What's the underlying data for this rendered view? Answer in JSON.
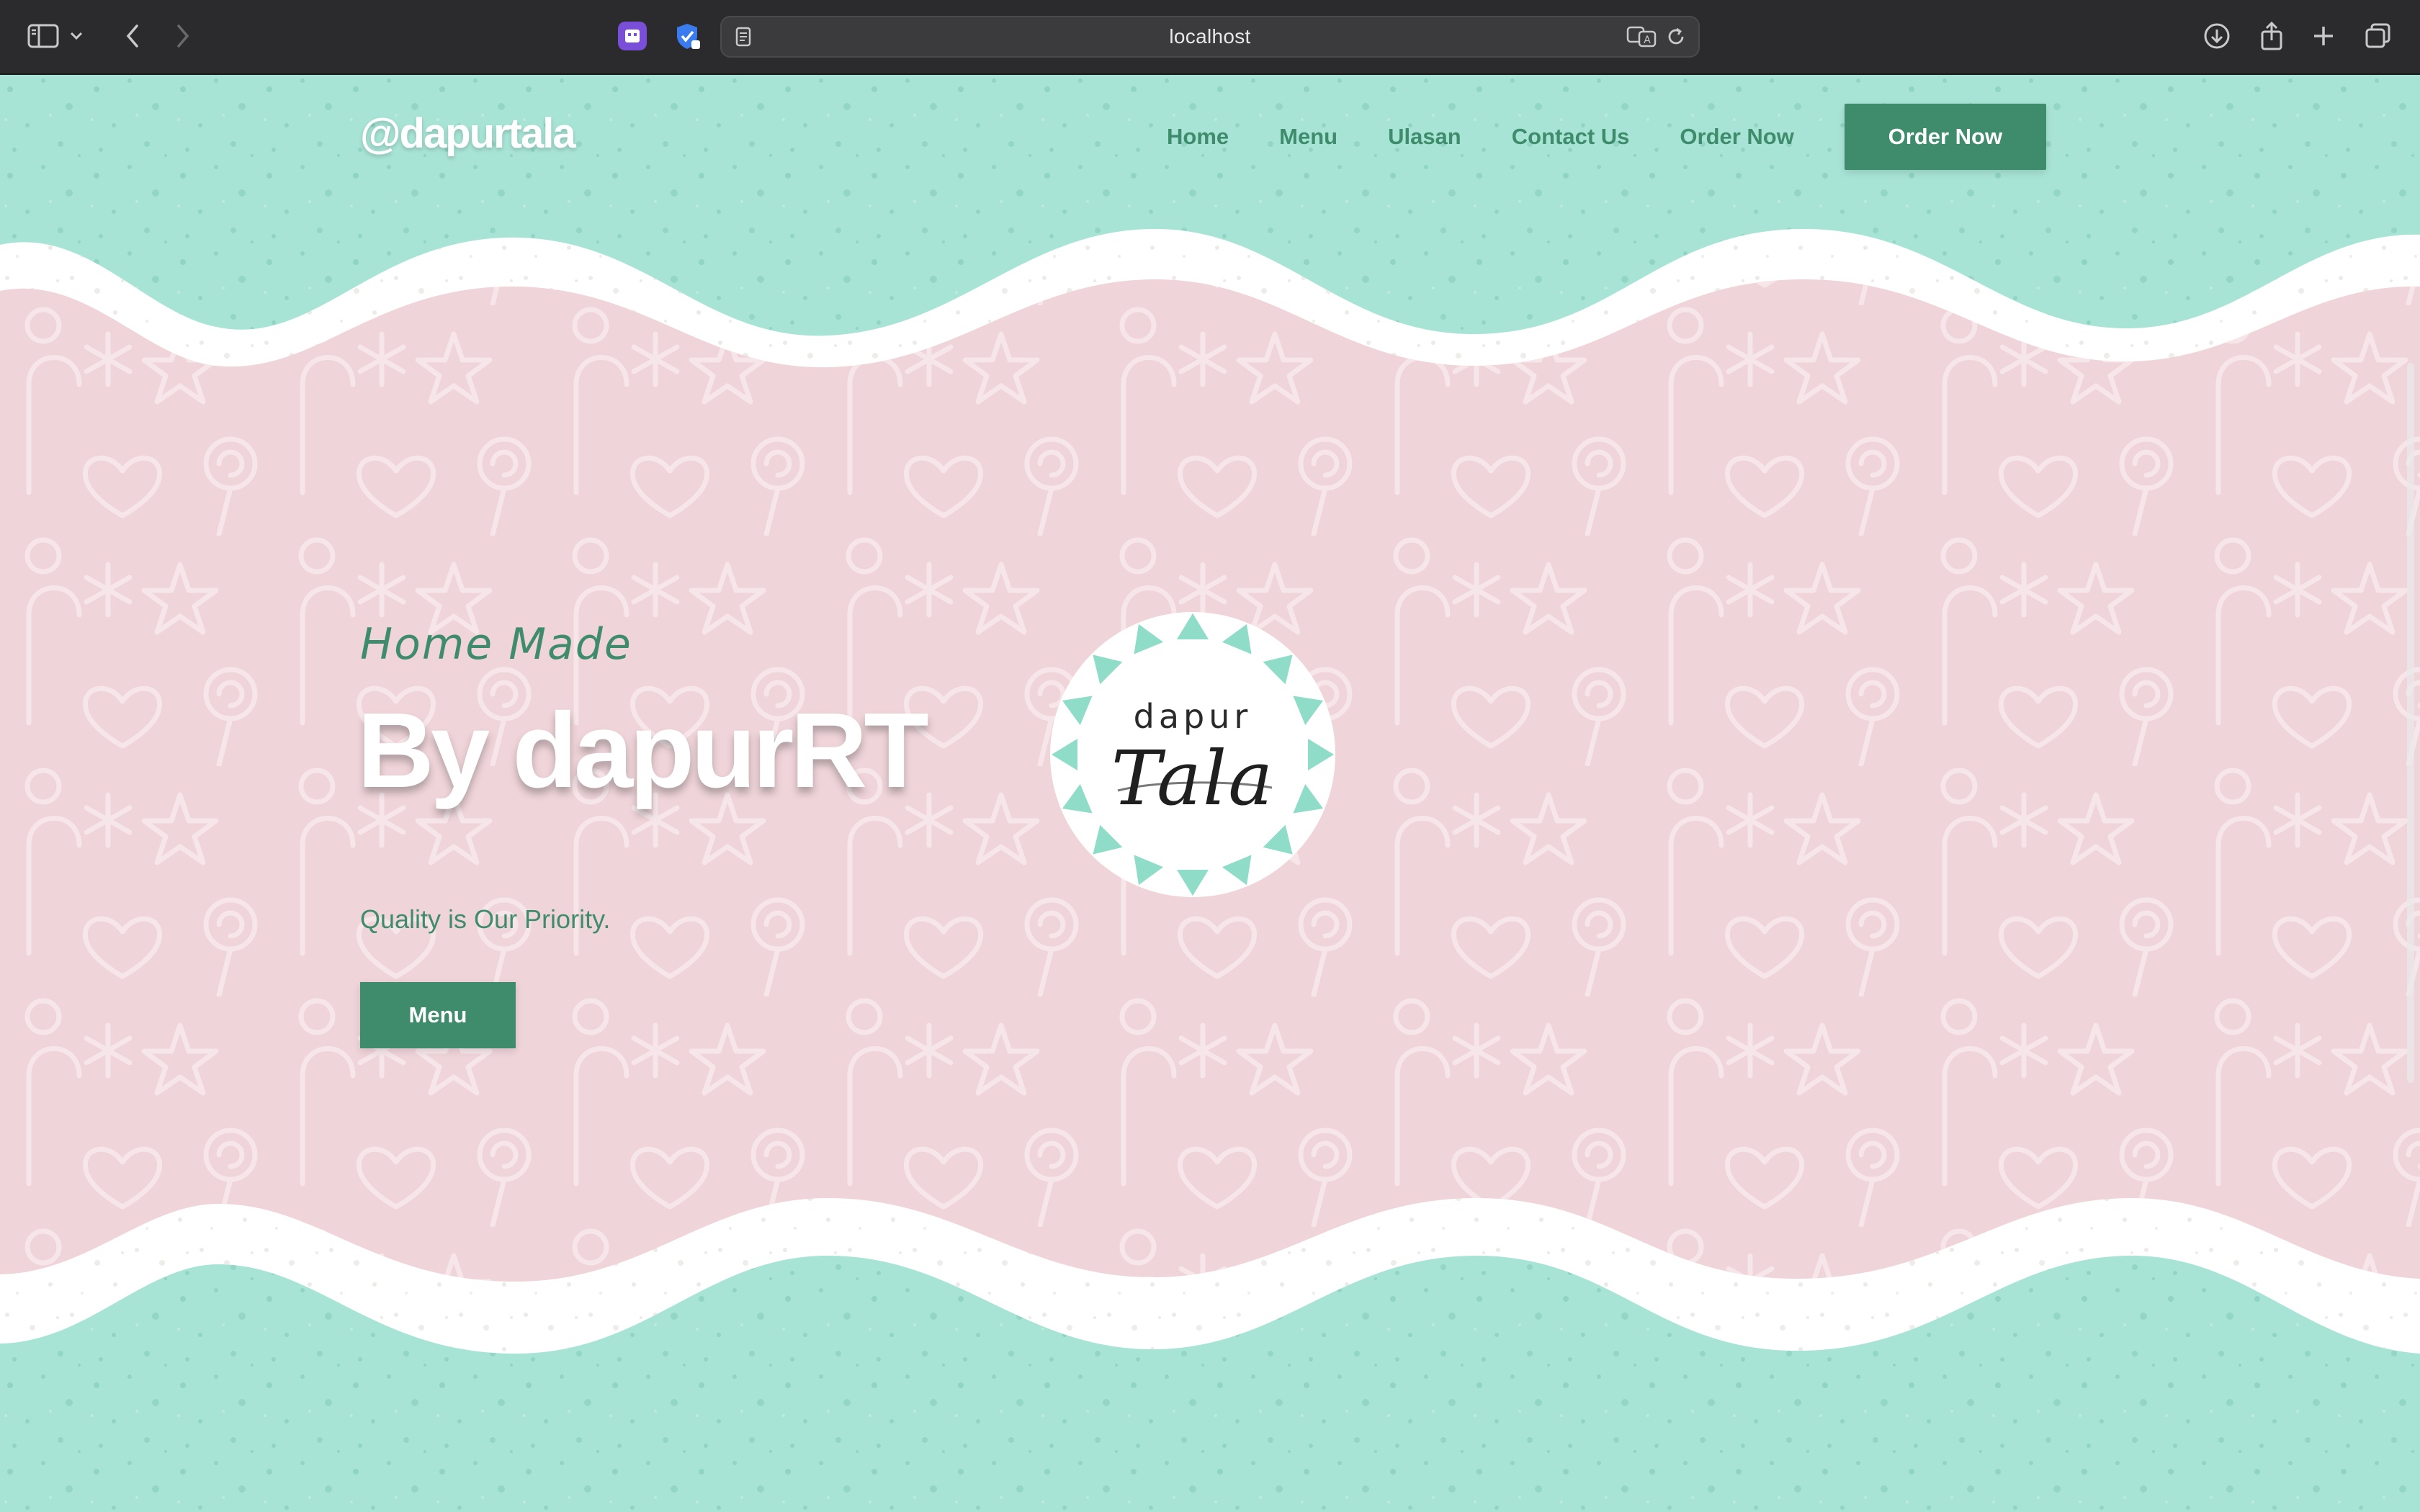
{
  "browser": {
    "address": "localhost"
  },
  "site": {
    "logo": "@dapurtala",
    "nav": {
      "items": [
        "Home",
        "Menu",
        "Ulasan",
        "Contact Us",
        "Order Now"
      ],
      "cta": "Order Now"
    }
  },
  "hero": {
    "eyebrow": "Home Made",
    "title": "By dapurRT",
    "subtitle": "Quality is Our Priority.",
    "button": "Menu"
  },
  "badge": {
    "top": "dapur",
    "script": "Tala"
  },
  "colors": {
    "mint": "#a8e4d6",
    "pink": "#efd4d9",
    "green": "#3e8c6c",
    "chrome": "#2b2b2d"
  }
}
